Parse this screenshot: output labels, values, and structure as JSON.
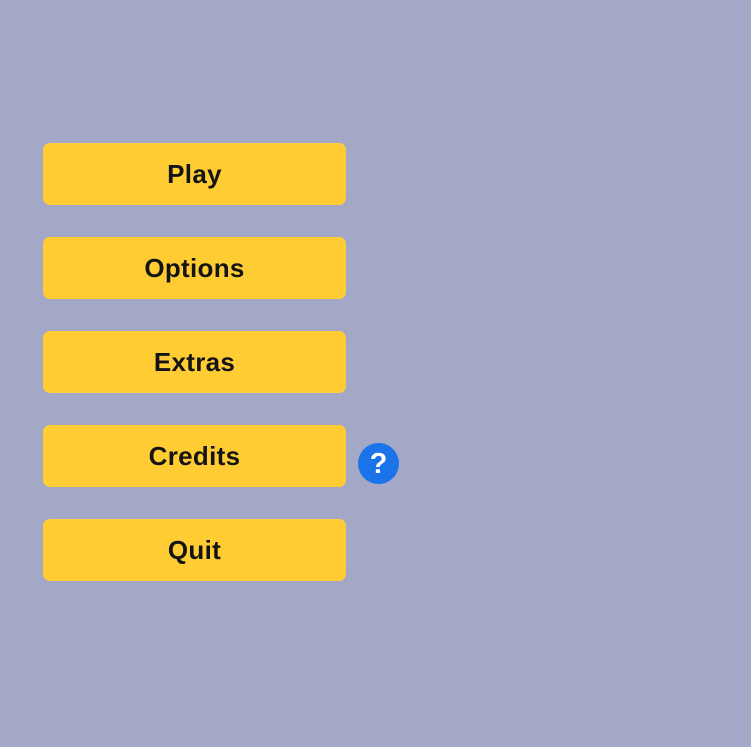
{
  "menu": {
    "play_label": "Play",
    "options_label": "Options",
    "extras_label": "Extras",
    "credits_label": "Credits",
    "quit_label": "Quit"
  },
  "help": {
    "icon": "question-mark-icon",
    "glyph": "?"
  },
  "colors": {
    "background": "#a3a8c7",
    "button": "#ffcd33",
    "button_text": "#141414",
    "help_icon": "#1a73e8"
  }
}
